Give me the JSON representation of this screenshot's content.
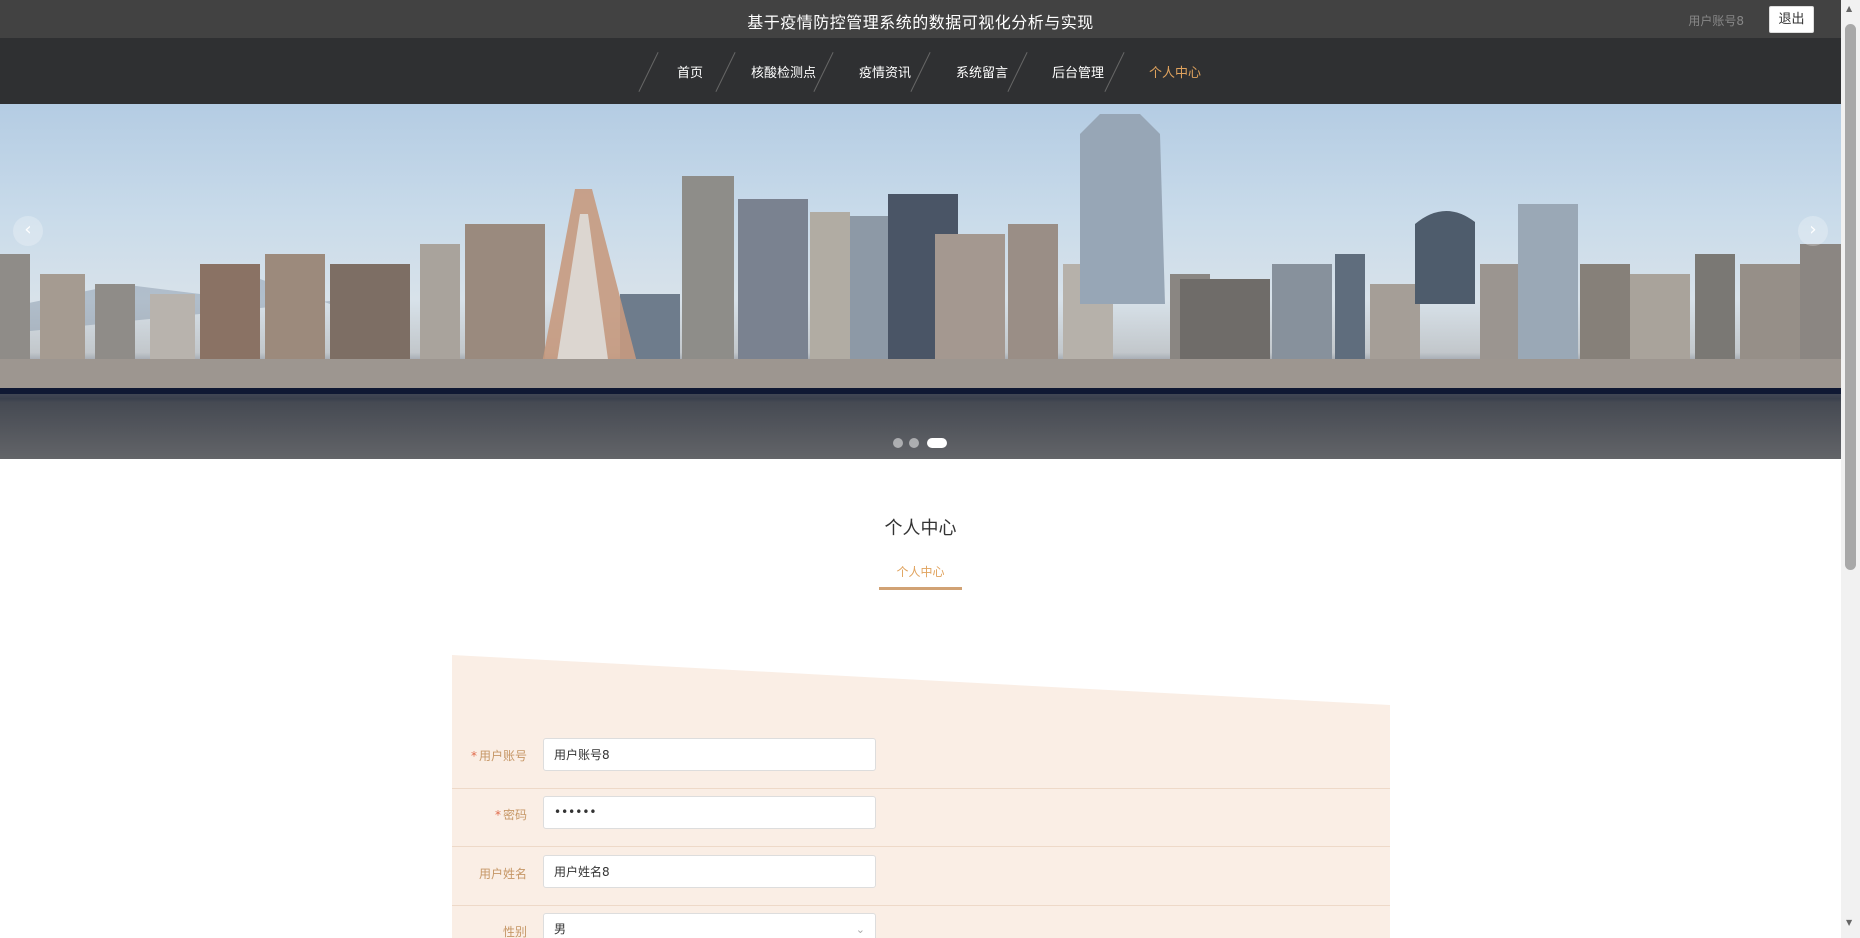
{
  "header": {
    "site_title": "基于疫情防控管理系统的数据可视化分析与实现",
    "user_account": "用户账号8",
    "logout_label": "退出"
  },
  "nav": {
    "items": [
      {
        "label": "首页"
      },
      {
        "label": "核酸检测点"
      },
      {
        "label": "疫情资讯"
      },
      {
        "label": "系统留言"
      },
      {
        "label": "后台管理"
      },
      {
        "label": "个人中心"
      }
    ],
    "active_index": 5
  },
  "banner": {
    "prev_arrow": "‹",
    "next_arrow": "›",
    "slide_count": 3,
    "active_slide": 3
  },
  "section": {
    "title": "个人中心",
    "tab_label": "个人中心"
  },
  "form": {
    "fields": [
      {
        "label": "用户账号",
        "required": true,
        "value": "用户账号8",
        "type": "text"
      },
      {
        "label": "密码",
        "required": true,
        "value": "••••••",
        "type": "password"
      },
      {
        "label": "用户姓名",
        "required": false,
        "value": "用户姓名8",
        "type": "text"
      },
      {
        "label": "性别",
        "required": false,
        "value": "男",
        "type": "select"
      }
    ],
    "required_mark": "*"
  },
  "colors": {
    "accent": "#e0a35e",
    "topbar": "#424242",
    "navbar": "#2f3032",
    "panel": "#faeee5",
    "label": "#c69766"
  },
  "icons": {
    "prev": "chevron-left-icon",
    "next": "chevron-right-icon",
    "select": "chevron-down-icon"
  }
}
